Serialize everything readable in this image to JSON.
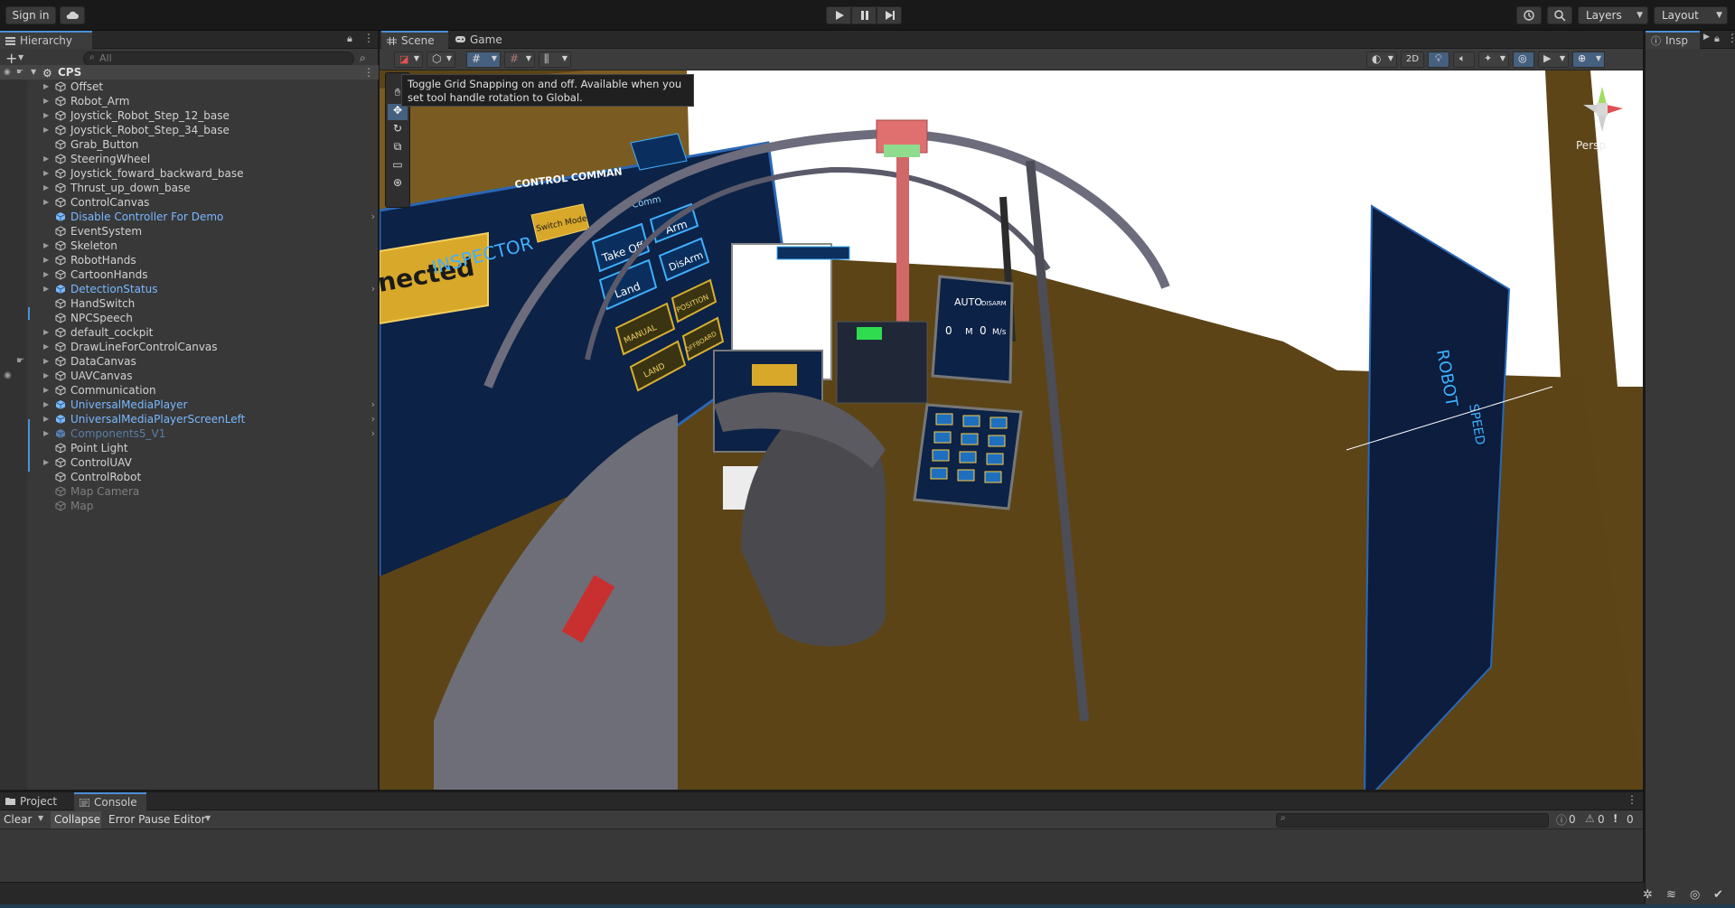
{
  "toolbar": {
    "sign_in": "Sign in",
    "layers": "Layers",
    "layout": "Layout"
  },
  "hierarchy": {
    "tab_label": "Hierarchy",
    "search_placeholder": "All",
    "root": "CPS",
    "items": [
      {
        "label": "Offset",
        "kind": "normal",
        "arrow": true
      },
      {
        "label": "Robot_Arm",
        "kind": "normal",
        "arrow": true
      },
      {
        "label": "Joystick_Robot_Step_12_base",
        "kind": "normal",
        "arrow": true
      },
      {
        "label": "Joystick_Robot_Step_34_base",
        "kind": "normal",
        "arrow": true
      },
      {
        "label": "Grab_Button",
        "kind": "normal",
        "arrow": false
      },
      {
        "label": "SteeringWheel",
        "kind": "normal",
        "arrow": true
      },
      {
        "label": "Joystick_foward_backward_base",
        "kind": "normal",
        "arrow": true
      },
      {
        "label": "Thrust_up_down_base",
        "kind": "normal",
        "arrow": true
      },
      {
        "label": "ControlCanvas",
        "kind": "normal",
        "arrow": true
      },
      {
        "label": "Disable Controller For Demo",
        "kind": "prefab",
        "arrow": false,
        "chev": true
      },
      {
        "label": "EventSystem",
        "kind": "normal",
        "arrow": false
      },
      {
        "label": "Skeleton",
        "kind": "normal",
        "arrow": true
      },
      {
        "label": "RobotHands",
        "kind": "normal",
        "arrow": true
      },
      {
        "label": "CartoonHands",
        "kind": "normal",
        "arrow": true
      },
      {
        "label": "DetectionStatus",
        "kind": "prefab",
        "arrow": true,
        "chev": true
      },
      {
        "label": "HandSwitch",
        "kind": "normal",
        "arrow": false
      },
      {
        "label": "NPCSpeech",
        "kind": "normal",
        "arrow": false
      },
      {
        "label": "default_cockpit",
        "kind": "normal",
        "arrow": true
      },
      {
        "label": "DrawLineForControlCanvas",
        "kind": "normal",
        "arrow": true
      },
      {
        "label": "DataCanvas",
        "kind": "normal",
        "arrow": true
      },
      {
        "label": "UAVCanvas",
        "kind": "normal",
        "arrow": true
      },
      {
        "label": "Communication",
        "kind": "normal",
        "arrow": true
      },
      {
        "label": "UniversalMediaPlayer",
        "kind": "prefab",
        "arrow": true,
        "chev": true
      },
      {
        "label": "UniversalMediaPlayerScreenLeft",
        "kind": "prefab",
        "arrow": true,
        "chev": true
      },
      {
        "label": "Components5_V1",
        "kind": "prefabdim",
        "arrow": true,
        "chev": true
      },
      {
        "label": "Point Light",
        "kind": "normal",
        "arrow": false
      },
      {
        "label": "ControlUAV",
        "kind": "normal",
        "arrow": true
      },
      {
        "label": "ControlRobot",
        "kind": "normal",
        "arrow": false
      },
      {
        "label": "Map Camera",
        "kind": "dim",
        "arrow": false
      },
      {
        "label": "Map",
        "kind": "dim",
        "arrow": false
      }
    ]
  },
  "scene": {
    "tab_scene": "Scene",
    "tab_game": "Game",
    "btn_2d": "2D",
    "persp": "Persp",
    "tooltip": "Toggle Grid Snapping on and off. Available when you set tool handle rotation to Global."
  },
  "cockpit": {
    "left_panel_title": "CONTROL COMMAN",
    "connected": "nected",
    "inspector": "INSPECTOR",
    "switch_mode": "Switch Mode",
    "command": "Comm",
    "take_off": "Take Off",
    "arm": "Arm",
    "land": "Land",
    "disarm": "DisArm",
    "manual": "MANUAL",
    "position": "POSITION",
    "land2": "LAND",
    "offboard": "OFFBOARD",
    "auto": "AUTO",
    "disarm2": "DISARM",
    "m": "M",
    "ms": "M/s",
    "zero": "0",
    "right_title": "ROBOT",
    "speed": "SPEED"
  },
  "inspector": {
    "tab_label": "Insp"
  },
  "bottom": {
    "tab_project": "Project",
    "tab_console": "Console",
    "clear": "Clear",
    "collapse": "Collapse",
    "error_pause": "Error Pause",
    "editor": "Editor",
    "count_info": "0",
    "count_warn": "0",
    "count_err": "0"
  }
}
